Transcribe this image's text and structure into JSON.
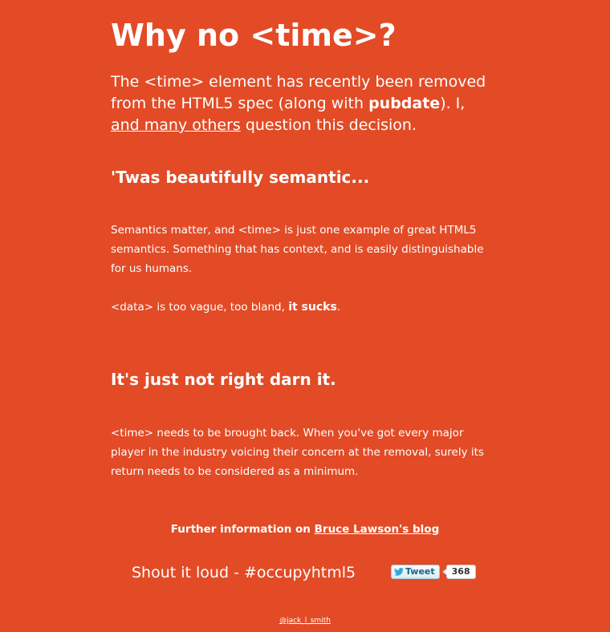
{
  "header": {
    "title": "Why no <time>?"
  },
  "intro": {
    "text_1": "The <time> element has recently been removed from the HTML5 spec (along with ",
    "bold": "pubdate",
    "text_2": "). I, ",
    "link_1": "and many others",
    "text_3": " question this decision."
  },
  "section_1": {
    "heading": "'Twas beautifully semantic...",
    "paragraph_1": "Semantics matter, and <time> is just one example of great HTML5 semantics. Something that has context, and is easily distinguishable for us humans.",
    "paragraph_2_text": "<data> is too vague, too bland, ",
    "paragraph_2_bold": "it sucks",
    "paragraph_2_end": "."
  },
  "section_2": {
    "heading": "It's just not right darn it.",
    "paragraph": "<time> needs to be brought back. When you've got every major player in the industry voicing their concern at the removal, surely its return needs to be considered as a minimum."
  },
  "further": {
    "text": "Further information on ",
    "link": "Bruce Lawson's blog"
  },
  "shout": {
    "text": "Shout it loud - #occupyhtml5"
  },
  "tweet": {
    "label": "Tweet",
    "count": "368",
    "icon": "twitter-bird-icon"
  },
  "footer": {
    "link": "@jack_l_smith"
  },
  "colors": {
    "background": "#e24b26",
    "text": "#ffffff",
    "tweet_text": "#186487"
  }
}
